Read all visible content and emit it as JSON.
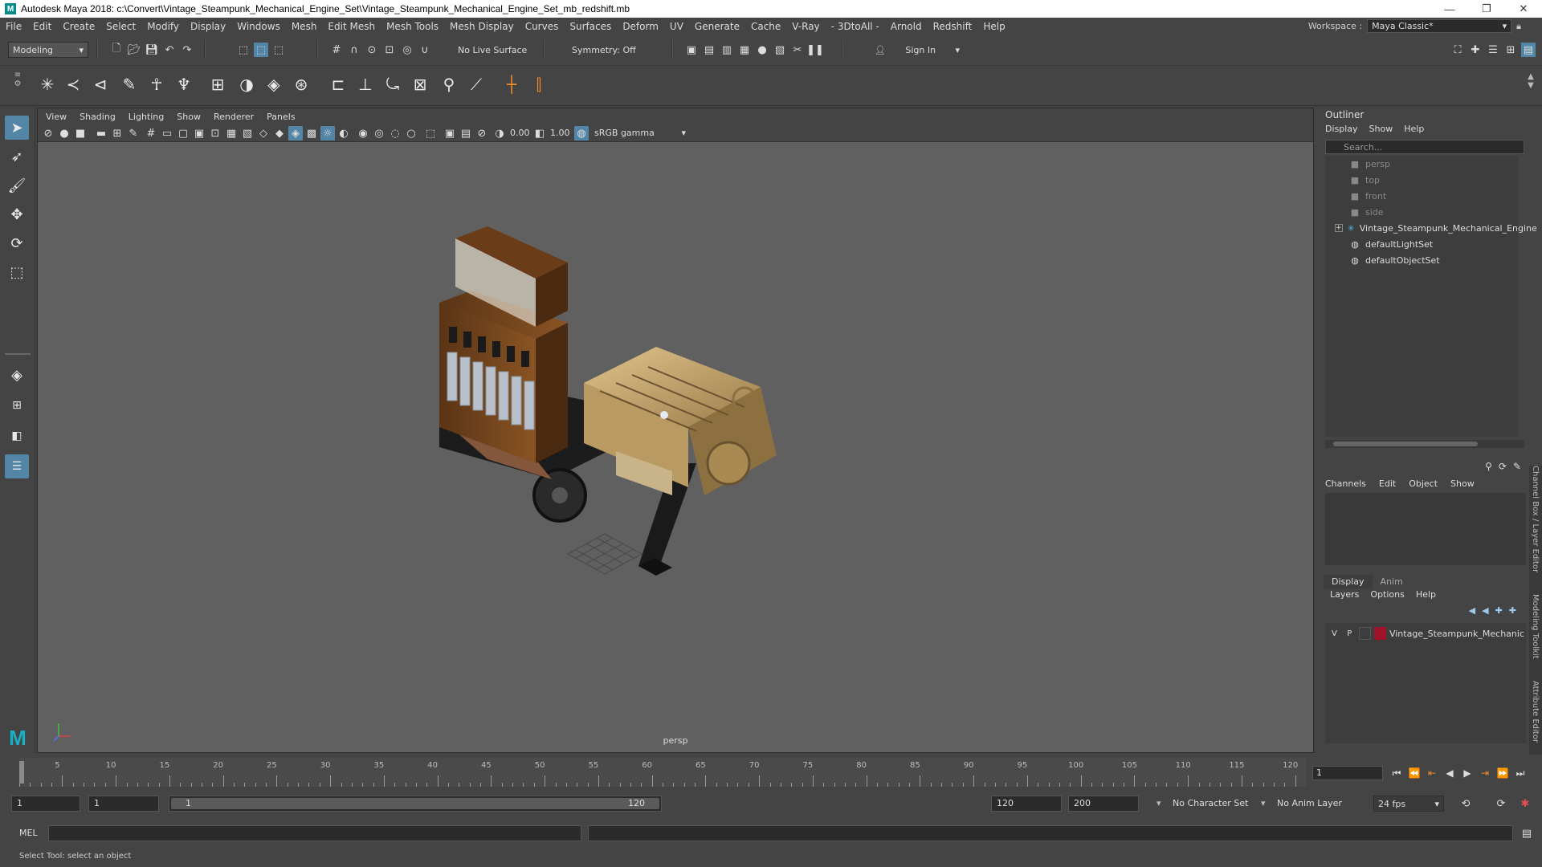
{
  "titlebar": {
    "title": "Autodesk Maya 2018: c:\\Convert\\Vintage_Steampunk_Mechanical_Engine_Set\\Vintage_Steampunk_Mechanical_Engine_Set_mb_redshift.mb",
    "min": "—",
    "max": "❐",
    "close": "✕"
  },
  "menubar": {
    "items": [
      "File",
      "Edit",
      "Create",
      "Select",
      "Modify",
      "Display",
      "Windows",
      "Mesh",
      "Edit Mesh",
      "Mesh Tools",
      "Mesh Display",
      "Curves",
      "Surfaces",
      "Deform",
      "UV",
      "Generate",
      "Cache",
      "V-Ray",
      "- 3DtoAll -",
      "Arnold",
      "Redshift",
      "Help"
    ],
    "workspace_label": "Workspace :",
    "workspace_value": "Maya Classic*"
  },
  "statusline": {
    "mode": "Modeling",
    "live_surface": "No Live Surface",
    "symmetry": "Symmetry: Off",
    "sign_in": "Sign In"
  },
  "viewport": {
    "menu": [
      "View",
      "Shading",
      "Lighting",
      "Show",
      "Renderer",
      "Panels"
    ],
    "exposure": "0.00",
    "gamma": "1.00",
    "color_space": "sRGB gamma",
    "camera_label": "persp"
  },
  "outliner": {
    "title": "Outliner",
    "menu": [
      "Display",
      "Show",
      "Help"
    ],
    "search_placeholder": "Search...",
    "items": [
      {
        "label": "persp",
        "dim": true
      },
      {
        "label": "top",
        "dim": true
      },
      {
        "label": "front",
        "dim": true
      },
      {
        "label": "side",
        "dim": true
      },
      {
        "label": "Vintage_Steampunk_Mechanical_Engine",
        "dim": false
      },
      {
        "label": "defaultLightSet",
        "dim": false
      },
      {
        "label": "defaultObjectSet",
        "dim": false
      }
    ]
  },
  "channelbox": {
    "menu": [
      "Channels",
      "Edit",
      "Object",
      "Show"
    ]
  },
  "layereditor": {
    "tabs": [
      "Display",
      "Anim"
    ],
    "menu": [
      "Layers",
      "Options",
      "Help"
    ],
    "layer": {
      "v": "V",
      "p": "P",
      "name": "Vintage_Steampunk_Mechanic",
      "color": "#a0122a"
    }
  },
  "vtabs": [
    "Channel Box / Layer Editor",
    "Modeling Toolkit",
    "Attribute Editor"
  ],
  "timeslider": {
    "ticks": [
      1,
      5,
      10,
      15,
      20,
      25,
      30,
      35,
      40,
      45,
      50,
      55,
      60,
      65,
      70,
      75,
      80,
      85,
      90,
      95,
      100,
      105,
      110,
      115,
      120
    ],
    "current_frame": "1"
  },
  "rangeslider": {
    "start": "1",
    "start2": "1",
    "range_start": "1",
    "range_end": "120",
    "end": "120",
    "end2": "200",
    "character_set": "No Character Set",
    "anim_layer": "No Anim Layer",
    "fps": "24 fps"
  },
  "cmdline": {
    "label": "MEL"
  },
  "helpline": {
    "text": "Select Tool: select an object"
  },
  "colors": {
    "accent": "#5285a6",
    "viewport_bg": "#606060",
    "ui_bg": "#444444"
  }
}
